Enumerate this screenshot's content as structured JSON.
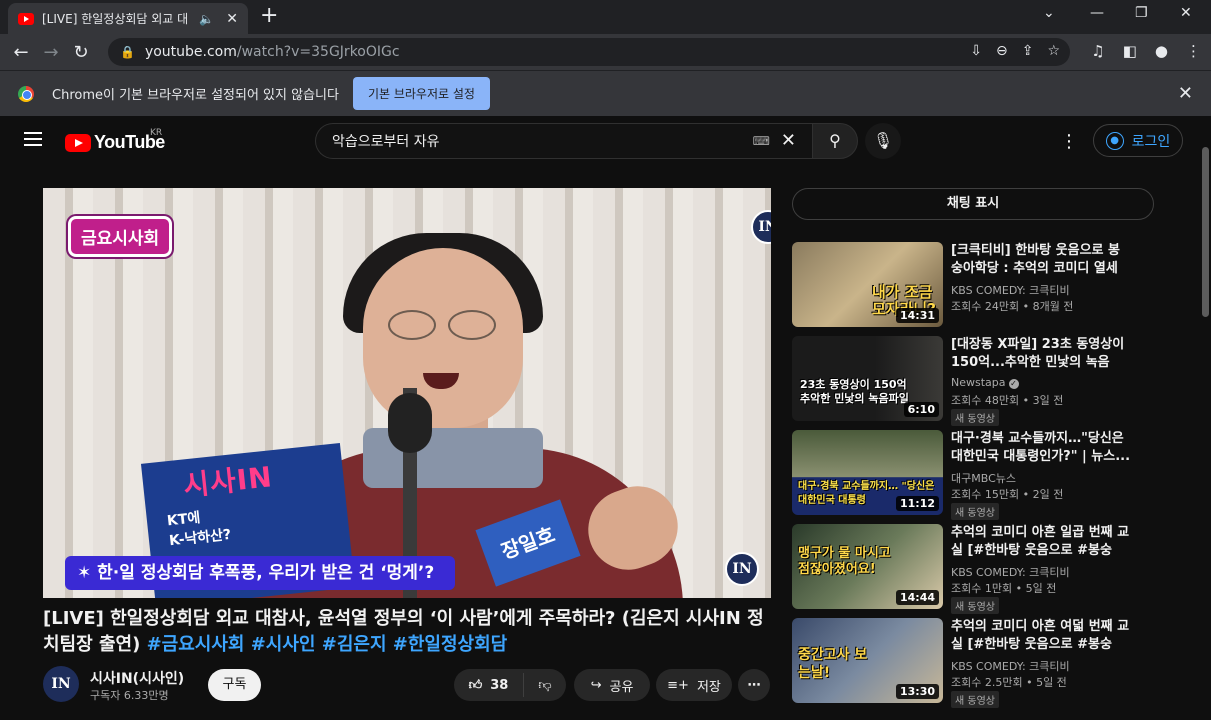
{
  "browser": {
    "tab_title": "[LIVE] 한일정상회담 외교 대",
    "url_host": "youtube.com",
    "url_path": "/watch?v=35GJrkoOIGc"
  },
  "infobar": {
    "message": "Chrome이 기본 브라우저로 설정되어 있지 않습니다",
    "button": "기본 브라우저로 설정"
  },
  "header": {
    "logo": "YouTube",
    "region": "KR",
    "search_value": "악습으로부터 자유",
    "login": "로그인"
  },
  "video": {
    "overlay_badge": "금요시사회",
    "overlay_caption": "✶ 한·일 정상회담 후폭풍, 우리가 받은 건 ‘멍게’?",
    "card_logo": "시사IN",
    "card_text_1": "KT에",
    "card_text_2": "K-낙하산?",
    "name_card": "장일호",
    "watermark": "IN",
    "title": "[LIVE] 한일정상회담 외교 대참사, 윤석열 정부의 ‘이 사람’에게 주목하라? (김은지 시사IN 정치팀장 출연) ",
    "hashtags": "#금요시사회 #시사인 #김은지 #한일정상회담",
    "channel_avatar": "IN",
    "channel_name": "시사IN(시사인)",
    "subscribers": "구독자 6.33만명",
    "subscribe": "구독",
    "likes": "38",
    "share": "공유",
    "save": "저장"
  },
  "sidebar": {
    "chat_toggle": "채팅 표시",
    "recommendations": [
      {
        "title": "[크큭티비] 한바탕 웃음으로 봉숭아학당 : 추억의 코미디 열세 번...",
        "channel": "KBS COMEDY: 크큭티비",
        "views": "조회수 24만회 • 8개월 전",
        "duration": "14:31",
        "thumb_text": "내가 조금 모자라니?",
        "is_new": false
      },
      {
        "title": "[대장동 X파일] 23초 동영상이 150억...추악한 민낯의 녹음파...",
        "channel": "Newstapa",
        "views": "조회수 48만회 • 3일 전",
        "duration": "6:10",
        "thumb_text": "23초 동영상이 150억 추악한 민낯의 녹음파일",
        "is_new": true,
        "new_label": "새 동영상"
      },
      {
        "title": "대구·경북 교수들까지…\"당신은 대한민국 대통령인가?\" | 뉴스...",
        "channel": "대구MBC뉴스",
        "views": "조회수 15만회 • 2일 전",
        "duration": "11:12",
        "thumb_text": "대구·경북 교수들까지… \"당신은 대한민국 대통령",
        "is_new": true,
        "new_label": "새 동영상"
      },
      {
        "title": "추억의 코미디 아흔 일곱 번째 교실 [#한바탕 웃음으로 #봉숭아...",
        "channel": "KBS COMEDY: 크큭티비",
        "views": "조회수 1만회 • 5일 전",
        "duration": "14:44",
        "thumb_text": "맹구가 물 마시고 점잖아졌어요!",
        "is_new": true,
        "new_label": "새 동영상"
      },
      {
        "title": "추억의 코미디 아흔 여덟 번째 교실 [#한바탕 웃음으로 #봉숭아...",
        "channel": "KBS COMEDY: 크큭티비",
        "views": "조회수 2.5만회 • 5일 전",
        "duration": "13:30",
        "thumb_text": "중간고사 보는날!",
        "is_new": true,
        "new_label": "새 동영상"
      }
    ]
  }
}
